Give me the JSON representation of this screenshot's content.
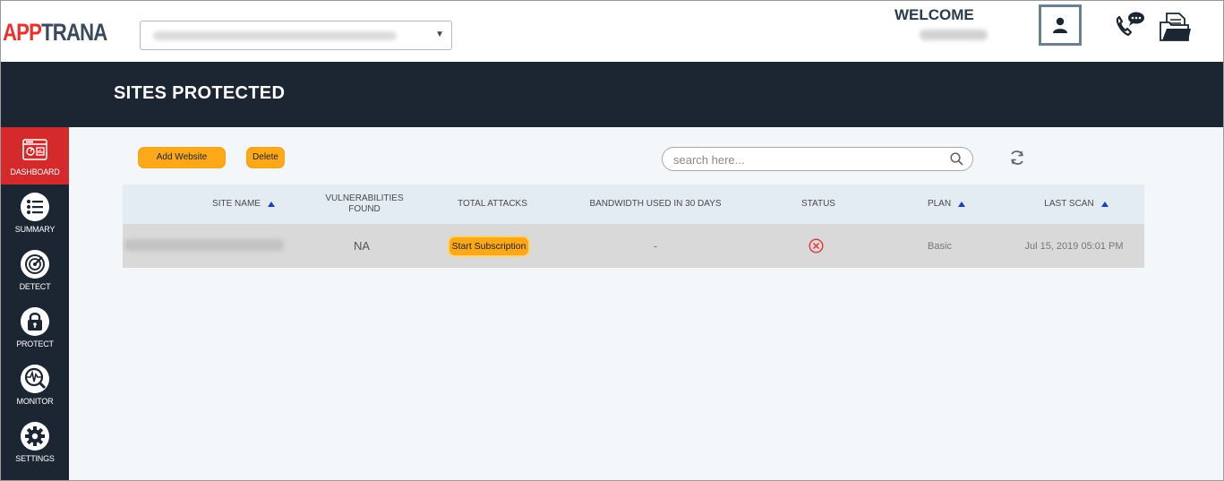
{
  "header": {
    "logo_part1": "APP",
    "logo_part2": "TRANA",
    "welcome": "WELCOME"
  },
  "page": {
    "title": "SITES PROTECTED"
  },
  "sidebar": {
    "items": [
      {
        "label": "DASHBOARD",
        "icon": "dashboard-icon",
        "active": true
      },
      {
        "label": "SUMMARY",
        "icon": "list-icon",
        "active": false
      },
      {
        "label": "DETECT",
        "icon": "radar-icon",
        "active": false
      },
      {
        "label": "PROTECT",
        "icon": "lock-icon",
        "active": false
      },
      {
        "label": "MONITOR",
        "icon": "pulse-icon",
        "active": false
      },
      {
        "label": "SETTINGS",
        "icon": "gear-icon",
        "active": false
      }
    ]
  },
  "toolbar": {
    "add_label": "Add Website",
    "delete_label": "Delete",
    "search_placeholder": "search here..."
  },
  "table": {
    "columns": {
      "site_name": "SITE NAME",
      "vuln_line1": "VULNERABILITIES",
      "vuln_line2": "FOUND",
      "total_attacks": "TOTAL ATTACKS",
      "bandwidth": "BANDWIDTH USED IN 30 DAYS",
      "status": "STATUS",
      "plan": "PLAN",
      "last_scan": "LAST SCAN"
    },
    "rows": [
      {
        "vulnerabilities": "NA",
        "attacks_button": "Start Subscription",
        "bandwidth": "-",
        "status_icon": "error-circle-icon",
        "plan": "Basic",
        "last_scan": "Jul 15, 2019 05:01 PM"
      }
    ]
  },
  "colors": {
    "brand_red": "#e8312c",
    "navy": "#1c2633",
    "accent_orange": "#fca819",
    "sort_blue": "#1a3fc4",
    "status_red": "#e0343a"
  }
}
